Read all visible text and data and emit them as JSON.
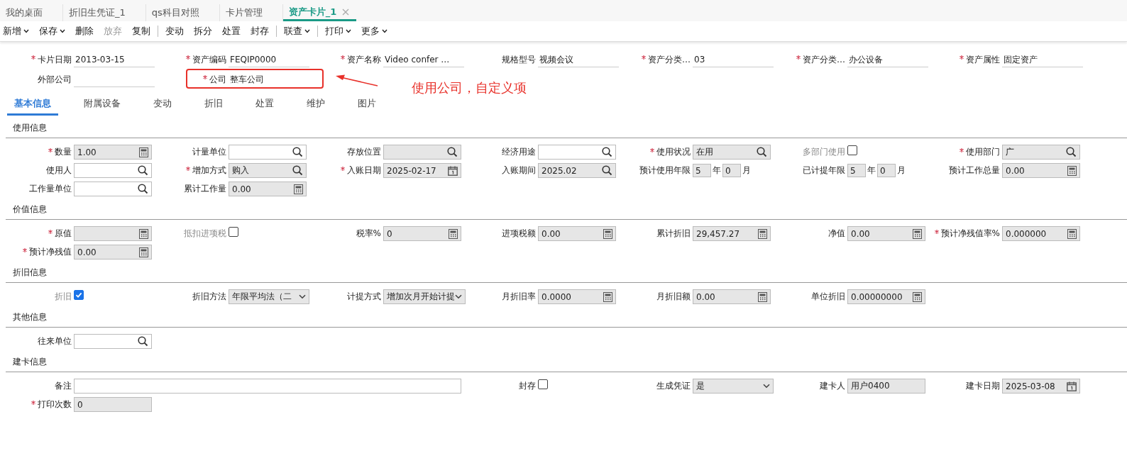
{
  "tabs": [
    {
      "label": "我的桌面",
      "selected": false,
      "closable": false
    },
    {
      "label": "折旧生凭证_1",
      "selected": false,
      "closable": false
    },
    {
      "label": "qs科目对照",
      "selected": false,
      "closable": false
    },
    {
      "label": "卡片管理",
      "selected": false,
      "closable": false
    },
    {
      "label": "资产卡片_1",
      "selected": true,
      "closable": true
    }
  ],
  "toolbar": [
    {
      "label": "新增",
      "dropdown": true,
      "disabled": false,
      "separator_after": false
    },
    {
      "label": "保存",
      "dropdown": true,
      "disabled": false,
      "separator_after": false
    },
    {
      "label": "删除",
      "dropdown": false,
      "disabled": false,
      "separator_after": false
    },
    {
      "label": "放弃",
      "dropdown": false,
      "disabled": true,
      "separator_after": false
    },
    {
      "label": "复制",
      "dropdown": false,
      "disabled": false,
      "separator_after": true
    },
    {
      "label": "变动",
      "dropdown": false,
      "disabled": false,
      "separator_after": false
    },
    {
      "label": "拆分",
      "dropdown": false,
      "disabled": false,
      "separator_after": false
    },
    {
      "label": "处置",
      "dropdown": false,
      "disabled": false,
      "separator_after": false
    },
    {
      "label": "封存",
      "dropdown": false,
      "disabled": false,
      "separator_after": true
    },
    {
      "label": "联查",
      "dropdown": true,
      "disabled": false,
      "separator_after": true
    },
    {
      "label": "打印",
      "dropdown": true,
      "disabled": false,
      "separator_after": false
    },
    {
      "label": "更多",
      "dropdown": true,
      "disabled": false,
      "separator_after": false
    }
  ],
  "header_fields": [
    {
      "label": "卡片日期",
      "required": true,
      "value": "2013-03-15",
      "highlighted": false
    },
    {
      "label": "资产编码",
      "required": true,
      "value": "FEQIP0000",
      "highlighted": false
    },
    {
      "label": "资产名称",
      "required": true,
      "value": "Video confer …",
      "highlighted": false
    },
    {
      "label": "规格型号",
      "required": false,
      "value": "视频会议",
      "highlighted": false
    },
    {
      "label": "资产分类…",
      "required": true,
      "value": "03",
      "highlighted": false
    },
    {
      "label": "资产分类…",
      "required": true,
      "value": "办公设备",
      "highlighted": false
    },
    {
      "label": "资产属性",
      "required": true,
      "value": "固定资产",
      "highlighted": false
    },
    {
      "label": "外部公司",
      "required": false,
      "highlighted": false
    },
    {
      "label": "公司",
      "required": true,
      "value": "整车公司",
      "highlighted": true
    }
  ],
  "annotation": {
    "text": "使用公司，自定义项"
  },
  "subtabs": [
    {
      "label": "基本信息",
      "selected": true
    },
    {
      "label": "附属设备",
      "selected": false
    },
    {
      "label": "变动",
      "selected": false
    },
    {
      "label": "折旧",
      "selected": false
    },
    {
      "label": "处置",
      "selected": false
    },
    {
      "label": "维护",
      "selected": false
    },
    {
      "label": "图片",
      "selected": false
    }
  ],
  "sections": [
    {
      "title": "使用信息",
      "items": [
        {
          "kind": "calc",
          "label": "数量",
          "required": true,
          "readonly": true,
          "value": "1.00"
        },
        {
          "kind": "lookup",
          "label": "计量单位",
          "required": false,
          "readonly": false
        },
        {
          "kind": "lookup",
          "label": "存放位置",
          "required": false,
          "readonly": true
        },
        {
          "kind": "lookup",
          "label": "经济用途",
          "required": false,
          "readonly": false
        },
        {
          "kind": "lookup",
          "label": "使用状况",
          "required": true,
          "readonly": true,
          "value": "在用"
        },
        {
          "kind": "checkbox",
          "label": "多部门使用",
          "checked": false,
          "disabled": true
        },
        {
          "kind": "lookup",
          "label": "使用部门",
          "required": true,
          "readonly": true,
          "value": "广"
        },
        {
          "kind": "lookup",
          "label": "使用人",
          "required": false,
          "readonly": false
        },
        {
          "kind": "lookup",
          "label": "增加方式",
          "required": true,
          "readonly": true,
          "value": "购入"
        },
        {
          "kind": "date",
          "label": "入账日期",
          "required": true,
          "readonly": true,
          "value": "2025-02-17"
        },
        {
          "kind": "lookup",
          "label": "入账期间",
          "required": false,
          "readonly": true,
          "value": "2025.02"
        },
        {
          "kind": "period",
          "label": "预计使用年限",
          "years": "5",
          "year_unit": "年",
          "months": "0",
          "month_unit": "月"
        },
        {
          "kind": "period",
          "label": "已计提年限",
          "years": "5",
          "year_unit": "年",
          "months": "0",
          "month_unit": "月"
        },
        {
          "kind": "calc",
          "label": "预计工作总量",
          "required": false,
          "readonly": true,
          "value": "0.00"
        },
        {
          "kind": "lookup",
          "label": "工作量单位",
          "required": false,
          "readonly": false
        },
        {
          "kind": "calc",
          "label": "累计工作量",
          "required": false,
          "readonly": true,
          "value": "0.00"
        }
      ]
    },
    {
      "title": "价值信息",
      "items": [
        {
          "kind": "calc",
          "label": "原值",
          "required": true,
          "readonly": true
        },
        {
          "kind": "checkbox",
          "label": "抵扣进项税",
          "checked": false,
          "disabled": true
        },
        {
          "kind": "calc",
          "label": "税率%",
          "required": false,
          "readonly": true,
          "value": "0"
        },
        {
          "kind": "calc",
          "label": "进项税额",
          "required": false,
          "readonly": true,
          "value": "0.00"
        },
        {
          "kind": "calc",
          "label": "累计折旧",
          "required": false,
          "readonly": true,
          "value": "29,457.27"
        },
        {
          "kind": "calc",
          "label": "净值",
          "required": false,
          "readonly": true,
          "value": "0.00"
        },
        {
          "kind": "calc",
          "label": "预计净残值率%",
          "required": true,
          "readonly": true,
          "value": "0.000000"
        },
        {
          "kind": "calc",
          "label": "预计净残值",
          "required": true,
          "readonly": true,
          "value": "0.00"
        }
      ]
    },
    {
      "title": "折旧信息",
      "items": [
        {
          "kind": "checkbox",
          "label": "折旧",
          "checked": true,
          "disabled": true
        },
        {
          "kind": "select",
          "label": "折旧方法",
          "required": false,
          "readonly": true,
          "value": "年限平均法（二"
        },
        {
          "kind": "select",
          "label": "计提方式",
          "required": false,
          "readonly": true,
          "value": "增加次月开始计提"
        },
        {
          "kind": "calc",
          "label": "月折旧率",
          "required": false,
          "readonly": true,
          "value": "0.0000"
        },
        {
          "kind": "calc",
          "label": "月折旧额",
          "required": false,
          "readonly": true,
          "value": "0.00"
        },
        {
          "kind": "calc",
          "label": "单位折旧",
          "required": false,
          "readonly": true,
          "value": "0.00000000"
        }
      ]
    },
    {
      "title": "其他信息",
      "items": [
        {
          "kind": "lookup",
          "label": "往来单位",
          "required": false,
          "readonly": false
        }
      ]
    },
    {
      "title": "建卡信息",
      "items": [
        {
          "kind": "memo",
          "label": "备注",
          "required": false,
          "readonly": false
        },
        {
          "kind": "checkbox",
          "label": "封存",
          "checked": false,
          "disabled": false
        },
        {
          "kind": "select",
          "label": "生成凭证",
          "required": false,
          "readonly": true,
          "value": "是"
        },
        {
          "kind": "text",
          "label": "建卡人",
          "required": false,
          "readonly": true,
          "value": "用户0400"
        },
        {
          "kind": "date",
          "label": "建卡日期",
          "required": false,
          "readonly": true,
          "value": "2025-03-08"
        },
        {
          "kind": "text",
          "label": "打印次数",
          "required": true,
          "readonly": true,
          "value": "0"
        }
      ]
    }
  ]
}
